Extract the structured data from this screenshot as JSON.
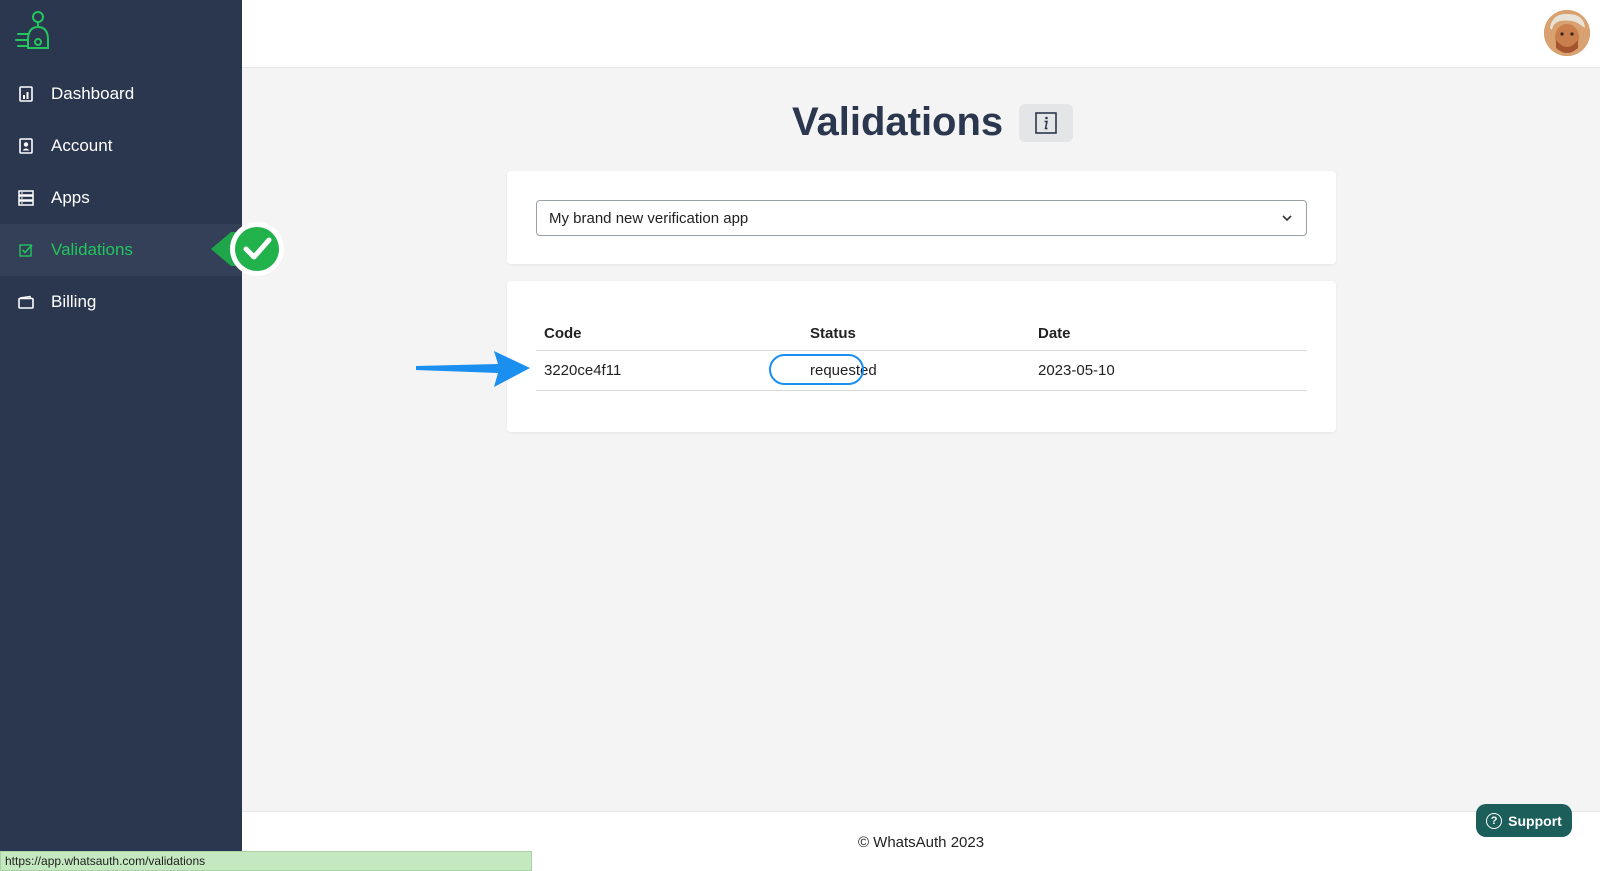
{
  "app": {
    "name": "WhatsAuth"
  },
  "sidebar": {
    "items": [
      {
        "label": "Dashboard",
        "icon": "dashboard-icon"
      },
      {
        "label": "Account",
        "icon": "account-icon"
      },
      {
        "label": "Apps",
        "icon": "apps-icon"
      },
      {
        "label": "Validations",
        "icon": "validations-icon",
        "active": true
      },
      {
        "label": "Billing",
        "icon": "billing-icon"
      }
    ]
  },
  "main": {
    "title": "Validations",
    "app_select": {
      "selected": "My brand new verification app"
    },
    "table": {
      "columns": [
        "Code",
        "Status",
        "Date"
      ],
      "rows": [
        {
          "code": "3220ce4f11",
          "status": "requested",
          "date": "2023-05-10"
        }
      ]
    }
  },
  "footer": {
    "copyright": "© WhatsAuth 2023"
  },
  "support": {
    "label": "Support"
  },
  "statusbar": {
    "url": "https://app.whatsauth.com/validations"
  },
  "colors": {
    "sidebar_bg": "#2b374e",
    "accent_green": "#22c55e",
    "highlight_blue": "#1a8ff0",
    "support_bg": "#1b5e5a"
  }
}
